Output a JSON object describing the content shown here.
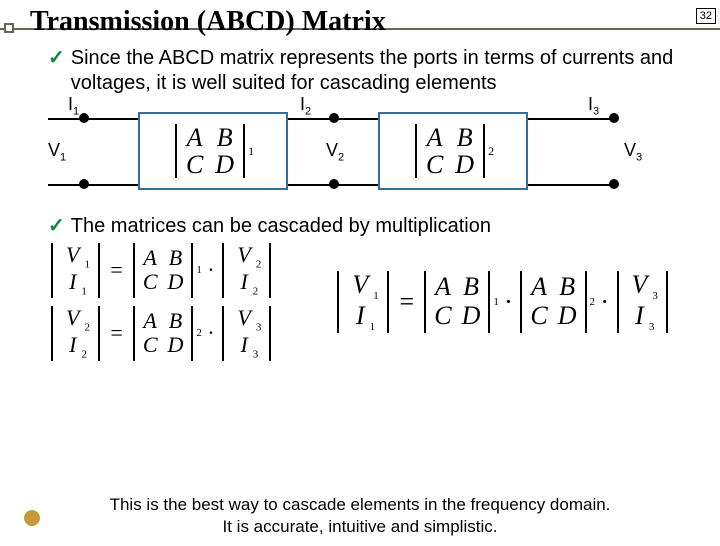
{
  "page_number": "32",
  "title": "Transmission (ABCD) Matrix",
  "bullets": {
    "b1": "Since the ABCD matrix represents the ports in terms of currents and voltages, it is well suited for cascading elements",
    "b2": "The matrices can be cascaded by multiplication"
  },
  "diagram": {
    "I1": "I",
    "I1s": "1",
    "I2": "I",
    "I2s": "2",
    "I3": "I",
    "I3s": "3",
    "V1": "V",
    "V1s": "1",
    "V2": "V",
    "V2s": "2",
    "V3": "V",
    "V3s": "3",
    "m1": {
      "A": "A",
      "B": "B",
      "C": "C",
      "D": "D",
      "sub": "1"
    },
    "m2": {
      "A": "A",
      "B": "B",
      "C": "C",
      "D": "D",
      "sub": "2"
    }
  },
  "eq": {
    "e1": {
      "l": [
        "V",
        "I"
      ],
      "ls": [
        "1",
        "1"
      ],
      "m": [
        "A",
        "B",
        "C",
        "D"
      ],
      "ms": "1",
      "r": [
        "V",
        "I"
      ],
      "rs": [
        "2",
        "2"
      ]
    },
    "e2": {
      "l": [
        "V",
        "I"
      ],
      "ls": [
        "2",
        "2"
      ],
      "m": [
        "A",
        "B",
        "C",
        "D"
      ],
      "ms": "2",
      "r": [
        "V",
        "I"
      ],
      "rs": [
        "3",
        "3"
      ]
    },
    "e3": {
      "l": [
        "V",
        "I"
      ],
      "ls": [
        "1",
        "1"
      ],
      "m1": [
        "A",
        "B",
        "C",
        "D"
      ],
      "m1s": "1",
      "m2": [
        "A",
        "B",
        "C",
        "D"
      ],
      "m2s": "2",
      "r": [
        "V",
        "I"
      ],
      "rs": [
        "3",
        "3"
      ]
    }
  },
  "footer": {
    "l1": "This is the best way to cascade elements in the frequency domain.",
    "l2": "It is accurate, intuitive and simplistic."
  }
}
